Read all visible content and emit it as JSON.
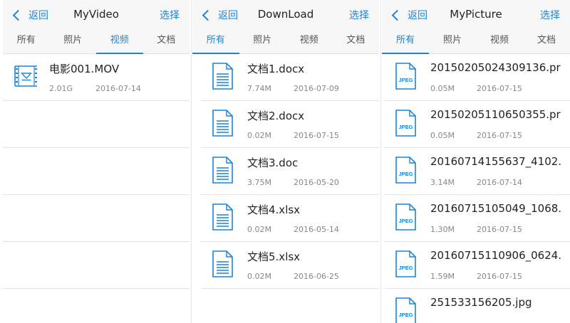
{
  "colors": {
    "accent": "#1d84d9",
    "bar_bg": "#f7f7f7",
    "divider": "#e4e4e4"
  },
  "panels": [
    {
      "back_label": "返回",
      "title": "MyVideo",
      "select_label": "选择",
      "tabs": [
        "所有",
        "照片",
        "视频",
        "文档"
      ],
      "active_tab": 2,
      "files": [
        {
          "name": "电影001.MOV",
          "size": "2.01G",
          "date": "2016-07-14",
          "icon": "video-file-icon"
        }
      ]
    },
    {
      "back_label": "返回",
      "title": "DownLoad",
      "select_label": "选择",
      "tabs": [
        "所有",
        "照片",
        "视频",
        "文档"
      ],
      "active_tab": 0,
      "files": [
        {
          "name": "文档1.docx",
          "size": "7.74M",
          "date": "2016-07-09",
          "icon": "document-file-icon"
        },
        {
          "name": "文档2.docx",
          "size": "0.02M",
          "date": "2016-07-15",
          "icon": "document-file-icon"
        },
        {
          "name": "文档3.doc",
          "size": "3.75M",
          "date": "2016-05-20",
          "icon": "document-file-icon"
        },
        {
          "name": "文档4.xlsx",
          "size": "0.02M",
          "date": "2016-05-14",
          "icon": "document-file-icon"
        },
        {
          "name": "文档5.xlsx",
          "size": "0.02M",
          "date": "2016-06-25",
          "icon": "document-file-icon"
        }
      ]
    },
    {
      "back_label": "返回",
      "title": "MyPicture",
      "select_label": "选择",
      "tabs": [
        "所有",
        "照片",
        "视频",
        "文档"
      ],
      "active_tab": 0,
      "jpeg_badge": "JPEG",
      "files": [
        {
          "name": "20150205024309136.pr",
          "size": "0.05M",
          "date": "2016-07-15",
          "icon": "jpeg-file-icon"
        },
        {
          "name": "20150205110650355.pr",
          "size": "0.05M",
          "date": "2016-07-15",
          "icon": "jpeg-file-icon"
        },
        {
          "name": "20160714155637_4102.",
          "size": "3.14M",
          "date": "2016-07-14",
          "icon": "jpeg-file-icon"
        },
        {
          "name": "20160715105049_1068.",
          "size": "1.30M",
          "date": "2016-07-15",
          "icon": "jpeg-file-icon"
        },
        {
          "name": "20160715110906_0624.",
          "size": "1.59M",
          "date": "2016-07-15",
          "icon": "jpeg-file-icon"
        },
        {
          "name": "251533156205.jpg",
          "size": "",
          "date": "",
          "icon": "jpeg-file-icon"
        }
      ]
    }
  ]
}
